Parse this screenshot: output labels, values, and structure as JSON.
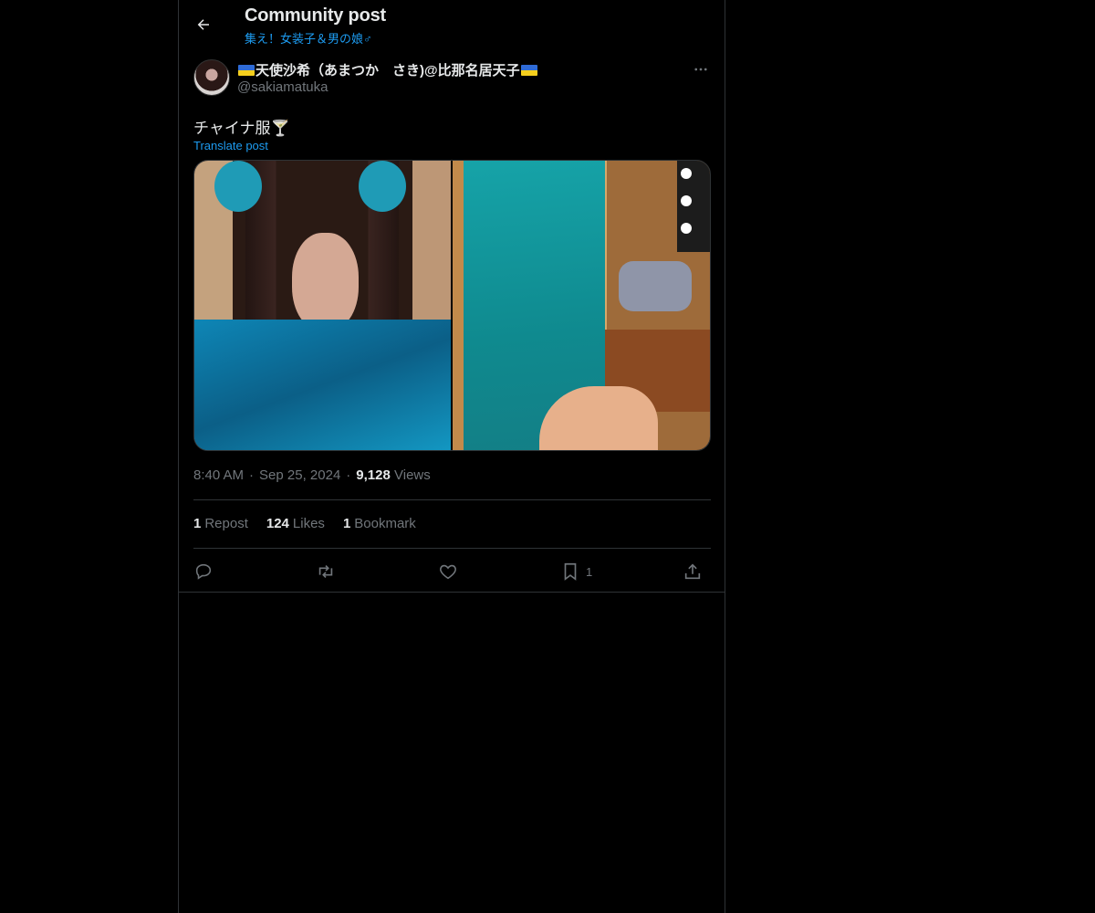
{
  "header": {
    "title": "Community post",
    "community": "集え！女装子＆男の娘♂"
  },
  "author": {
    "display_name": "天使沙希（あまつか　さき)@比那名居天子",
    "handle": "@sakiamatuka"
  },
  "post": {
    "text": "チャイナ服🍸",
    "translate_label": "Translate post"
  },
  "meta": {
    "time": "8:40 AM",
    "date": "Sep 25, 2024",
    "views_count": "9,128",
    "views_label": "Views",
    "separator": "·"
  },
  "stats": {
    "reposts_count": "1",
    "reposts_label": "Repost",
    "likes_count": "124",
    "likes_label": "Likes",
    "bookmarks_count": "1",
    "bookmarks_label": "Bookmark"
  },
  "actions": {
    "bookmark_count": "1"
  },
  "icons": {
    "back": "arrow-left-icon",
    "more": "more-horizontal-icon",
    "reply": "reply-icon",
    "repost": "repost-icon",
    "like": "heart-icon",
    "bookmark": "bookmark-icon",
    "share": "share-icon"
  },
  "colors": {
    "accent": "#1d9bf0",
    "muted": "#71767b",
    "text": "#e7e9ea",
    "border": "#2f3336",
    "background": "#000000"
  }
}
